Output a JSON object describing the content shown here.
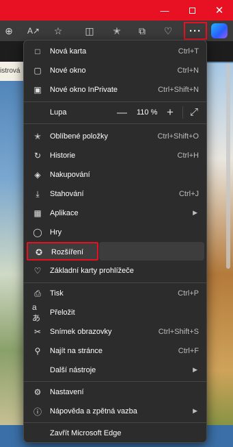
{
  "window": {
    "minimize_icon": "minimize-icon",
    "restore_icon": "restore-icon",
    "close_icon": "close-icon"
  },
  "toolbar": {
    "more_label": "···"
  },
  "page": {
    "site_partial": "istrová"
  },
  "menu": {
    "items": [
      {
        "label": "Nová karta",
        "shortcut": "Ctrl+T",
        "icon": "new-tab-icon"
      },
      {
        "label": "Nové okno",
        "shortcut": "Ctrl+N",
        "icon": "new-window-icon"
      },
      {
        "label": "Nové okno InPrivate",
        "shortcut": "Ctrl+Shift+N",
        "icon": "inprivate-icon"
      },
      {
        "label": "Lupa",
        "zoom": "110 %"
      },
      {
        "label": "Oblíbené položky",
        "shortcut": "Ctrl+Shift+O",
        "icon": "favorites-icon"
      },
      {
        "label": "Historie",
        "shortcut": "Ctrl+H",
        "icon": "history-icon"
      },
      {
        "label": "Nakupování",
        "shortcut": "",
        "icon": "shopping-icon"
      },
      {
        "label": "Stahování",
        "shortcut": "Ctrl+J",
        "icon": "download-icon"
      },
      {
        "label": "Aplikace",
        "shortcut": "",
        "icon": "apps-icon"
      },
      {
        "label": "Hry",
        "shortcut": "",
        "icon": "games-icon"
      },
      {
        "label": "Rozšíření",
        "shortcut": "",
        "icon": "extensions-icon"
      },
      {
        "label": "Základní karty prohlížeče",
        "shortcut": "",
        "icon": "browser-essentials-icon"
      },
      {
        "label": "Tisk",
        "shortcut": "Ctrl+P",
        "icon": "print-icon"
      },
      {
        "label": "Přeložit",
        "shortcut": "",
        "icon": "translate-icon"
      },
      {
        "label": "Snímek obrazovky",
        "shortcut": "Ctrl+Shift+S",
        "icon": "screenshot-icon"
      },
      {
        "label": "Najít na stránce",
        "shortcut": "Ctrl+F",
        "icon": "find-icon"
      },
      {
        "label": "Další nástroje",
        "shortcut": ""
      },
      {
        "label": "Nastavení",
        "shortcut": "",
        "icon": "settings-icon"
      },
      {
        "label": "Nápověda a zpětná vazba",
        "shortcut": "",
        "icon": "help-icon"
      },
      {
        "label": "Zavřít Microsoft Edge",
        "shortcut": ""
      }
    ]
  }
}
